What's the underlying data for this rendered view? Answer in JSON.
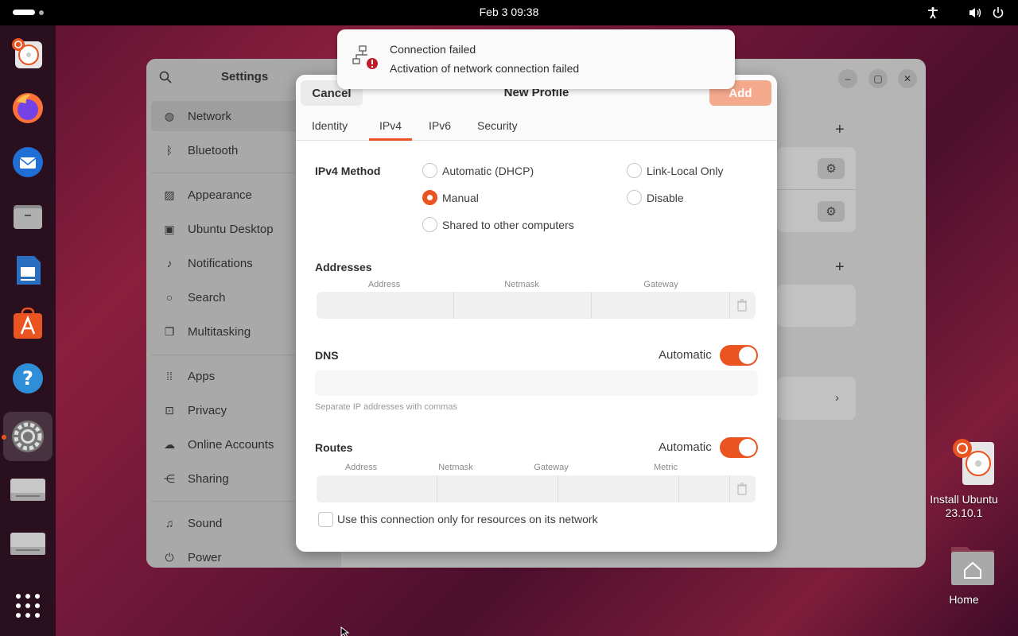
{
  "topbar": {
    "clock": "Feb 3  09:38",
    "icons": [
      "accessibility-icon",
      "volume-icon",
      "power-icon"
    ]
  },
  "dock": {
    "items": [
      "install-ubuntu",
      "firefox",
      "thunderbird",
      "files",
      "libreoffice-writer",
      "app-center",
      "help",
      "settings",
      "drive-1",
      "drive-2",
      "show-apps"
    ],
    "active": "settings"
  },
  "settings": {
    "title": "Settings",
    "sidebar": [
      {
        "label": "Network",
        "icon": "network-icon",
        "selected": true
      },
      {
        "label": "Bluetooth",
        "icon": "bluetooth-icon"
      },
      {
        "label": "Appearance",
        "icon": "appearance-icon"
      },
      {
        "label": "Ubuntu Desktop",
        "icon": "desktop-icon"
      },
      {
        "label": "Notifications",
        "icon": "bell-icon"
      },
      {
        "label": "Search",
        "icon": "search-icon"
      },
      {
        "label": "Multitasking",
        "icon": "multitasking-icon"
      },
      {
        "label": "Apps",
        "icon": "apps-icon"
      },
      {
        "label": "Privacy",
        "icon": "lock-icon"
      },
      {
        "label": "Online Accounts",
        "icon": "cloud-icon"
      },
      {
        "label": "Sharing",
        "icon": "share-icon"
      },
      {
        "label": "Sound",
        "icon": "music-icon"
      },
      {
        "label": "Power",
        "icon": "power-icon"
      }
    ]
  },
  "notification": {
    "title": "Connection failed",
    "body": "Activation of network connection failed"
  },
  "dialog": {
    "title": "New Profile",
    "cancel": "Cancel",
    "add": "Add",
    "tabs": [
      "Identity",
      "IPv4",
      "IPv6",
      "Security"
    ],
    "active_tab": "IPv4",
    "ipv4_method_label": "IPv4 Method",
    "methods": {
      "auto_dhcp": "Automatic (DHCP)",
      "manual": "Manual",
      "shared": "Shared to other computers",
      "link_local": "Link-Local Only",
      "disable": "Disable"
    },
    "selected_method": "Manual",
    "addresses": {
      "label": "Addresses",
      "columns": [
        "Address",
        "Netmask",
        "Gateway"
      ]
    },
    "dns": {
      "label": "DNS",
      "automatic_label": "Automatic",
      "automatic": true,
      "hint": "Separate IP addresses with commas"
    },
    "routes": {
      "label": "Routes",
      "automatic_label": "Automatic",
      "automatic": true,
      "columns": [
        "Address",
        "Netmask",
        "Gateway",
        "Metric"
      ]
    },
    "only_resources_label": "Use this connection only for resources on its network",
    "only_resources": false
  },
  "desktop": {
    "install_label_1": "Install Ubuntu",
    "install_label_2": "23.10.1",
    "home_label": "Home"
  },
  "colors": {
    "accent": "#e95420",
    "add_disabled": "#f5a98c"
  }
}
